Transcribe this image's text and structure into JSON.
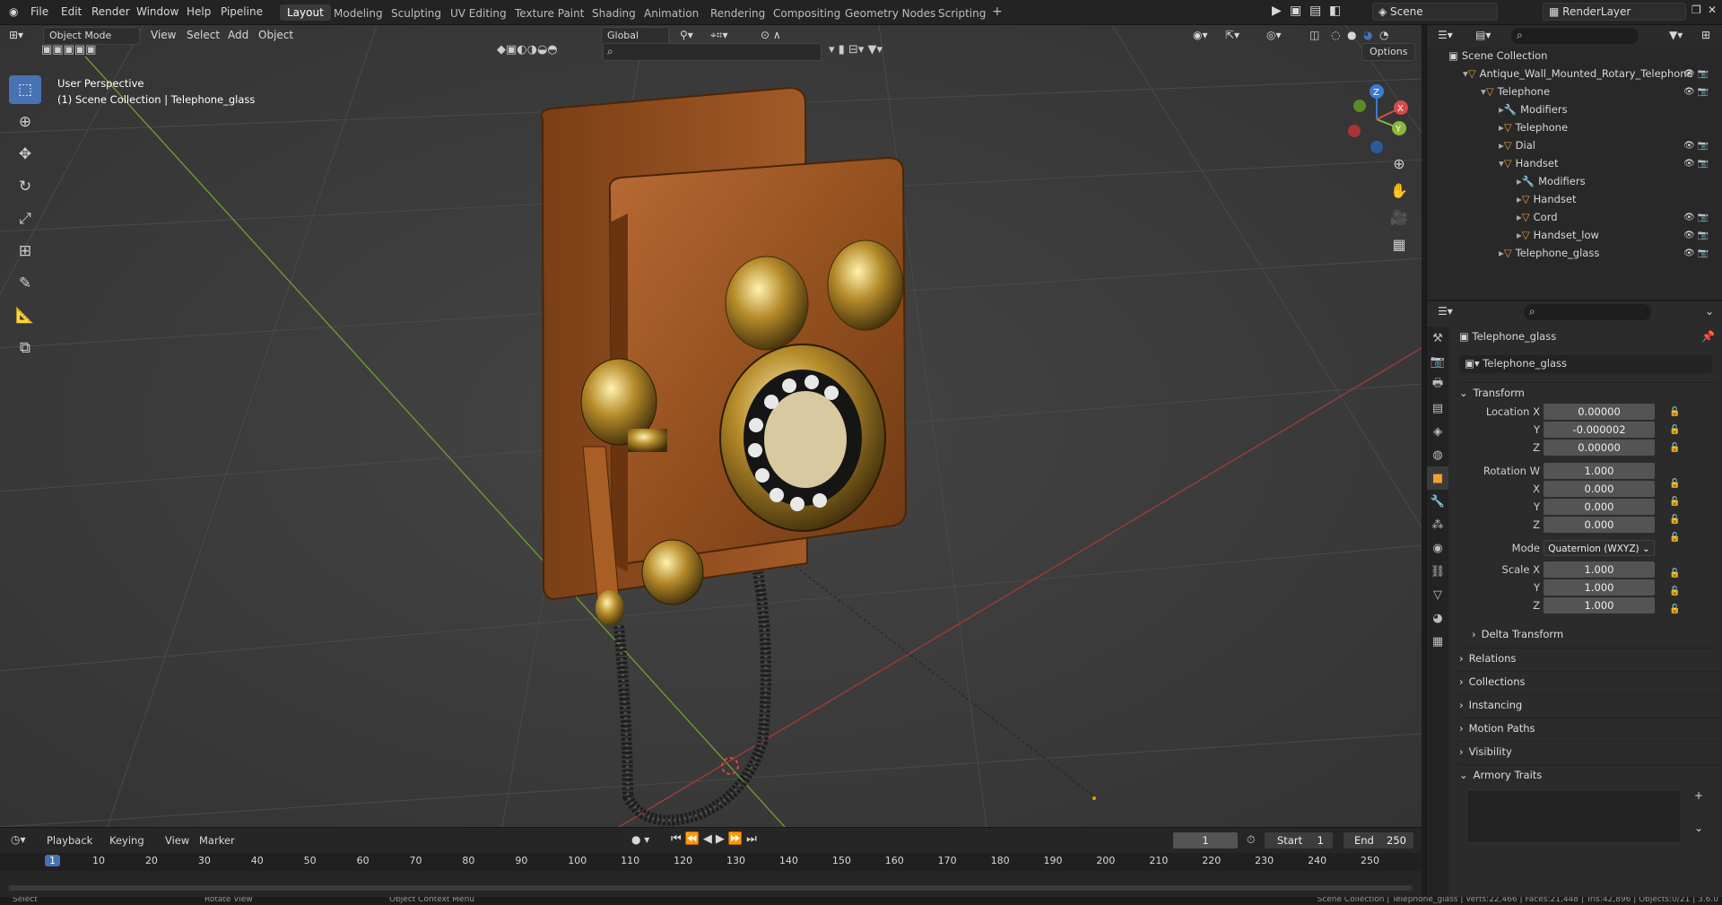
{
  "menus": {
    "file": "File",
    "edit": "Edit",
    "render": "Render",
    "window": "Window",
    "help": "Help",
    "pipeline": "Pipeline"
  },
  "workspaces": [
    "Layout",
    "Modeling",
    "Sculpting",
    "UV Editing",
    "Texture Paint",
    "Shading",
    "Animation",
    "Rendering",
    "Compositing",
    "Geometry Nodes",
    "Scripting"
  ],
  "topright": {
    "scene": "Scene",
    "renderlayer": "RenderLayer"
  },
  "viewport": {
    "mode": "Object Mode",
    "view": "View",
    "select": "Select",
    "add": "Add",
    "object": "Object",
    "orientation": "Global",
    "options": "Options",
    "perspective": "User Perspective",
    "collection_path": "(1) Scene Collection | Telephone_glass",
    "gizmo": {
      "x": "X",
      "y": "Y",
      "z": "Z"
    }
  },
  "outliner": {
    "root": "Scene Collection",
    "items": [
      {
        "label": "Antique_Wall_Mounted_Rotary_Telephone",
        "indent": 0
      },
      {
        "label": "Telephone",
        "indent": 1
      },
      {
        "label": "Modifiers",
        "indent": 2
      },
      {
        "label": "Telephone",
        "indent": 2
      },
      {
        "label": "Dial",
        "indent": 2
      },
      {
        "label": "Handset",
        "indent": 2
      },
      {
        "label": "Modifiers",
        "indent": 3
      },
      {
        "label": "Handset",
        "indent": 3
      },
      {
        "label": "Cord",
        "indent": 3
      },
      {
        "label": "Handset_low",
        "indent": 3
      },
      {
        "label": "Telephone_glass",
        "indent": 2
      }
    ]
  },
  "properties": {
    "object_name": "Telephone_glass",
    "datablock": "Telephone_glass",
    "transform": "Transform",
    "location_x_label": "Location X",
    "y_label": "Y",
    "z_label": "Z",
    "location": [
      "0.00000",
      "-0.000002",
      "0.00000"
    ],
    "rotation_w_label": "Rotation W",
    "x_label": "X",
    "rotation": [
      "1.000",
      "0.000",
      "0.000",
      "0.000"
    ],
    "mode_label": "Mode",
    "mode_value": "Quaternion (WXYZ)",
    "scale_x_label": "Scale X",
    "scale": [
      "1.000",
      "1.000",
      "1.000"
    ],
    "panels": [
      "Delta Transform",
      "Relations",
      "Collections",
      "Instancing",
      "Motion Paths",
      "Visibility",
      "Armory Traits"
    ]
  },
  "timeline": {
    "playback": "Playback",
    "keying": "Keying",
    "view": "View",
    "marker": "Marker",
    "current": "1",
    "start_label": "Start",
    "start": "1",
    "end_label": "End",
    "end": "250",
    "ticks": [
      "1",
      "10",
      "20",
      "30",
      "40",
      "50",
      "60",
      "70",
      "80",
      "90",
      "100",
      "110",
      "120",
      "130",
      "140",
      "150",
      "160",
      "170",
      "180",
      "190",
      "200",
      "210",
      "220",
      "230",
      "240",
      "250"
    ]
  },
  "status": {
    "select": "Select",
    "rotate": "Rotate View",
    "context": "Object Context Menu",
    "info": "Scene Collection | Telephone_glass | Verts:22,466 | Faces:21,448 | Tris:42,896 | Objects:0/21 | 3.6.0"
  }
}
